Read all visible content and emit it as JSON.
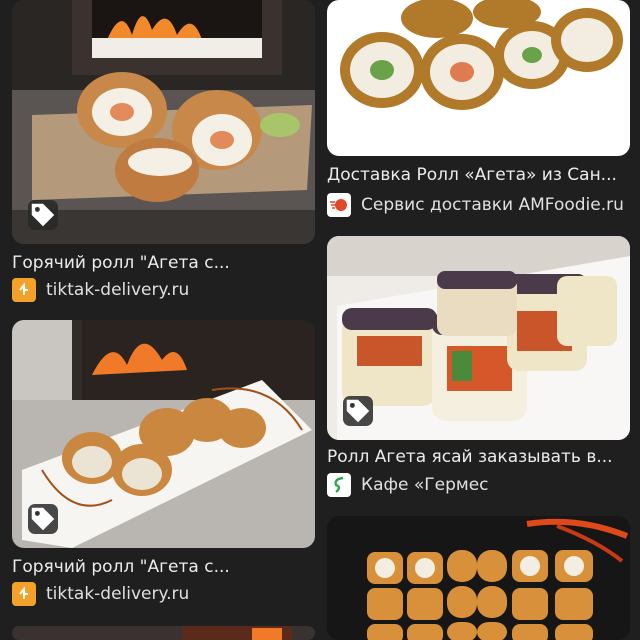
{
  "results": {
    "left": [
      {
        "title": "Горячий ролл \"Агета с...",
        "source": "tiktak-delivery.ru",
        "favicon": "tiktak-favicon",
        "has_tag": true
      },
      {
        "title": "Горячий ролл \"Агета с...",
        "source": "tiktak-delivery.ru",
        "favicon": "tiktak-favicon",
        "has_tag": true
      },
      {
        "title": "",
        "source": ""
      }
    ],
    "right": [
      {
        "title": "Доставка Ролл «Агета» из Сан...",
        "source": "Сервис доставки AMFoodie.ru",
        "favicon": "amfoodie-favicon",
        "has_tag": false
      },
      {
        "title": "Ролл Агета ясай заказывать в...",
        "source": "Кафе «Гермес",
        "favicon": "germes-favicon",
        "has_tag": true
      },
      {
        "title": "",
        "source": ""
      }
    ]
  },
  "icons": {
    "tag": "tag-icon"
  },
  "colors": {
    "background": "#1f1f1f",
    "text": "#ececec",
    "tiktak": "#f4a12a",
    "amfoodie": "#e0482a",
    "germes": "#2ea84a"
  }
}
